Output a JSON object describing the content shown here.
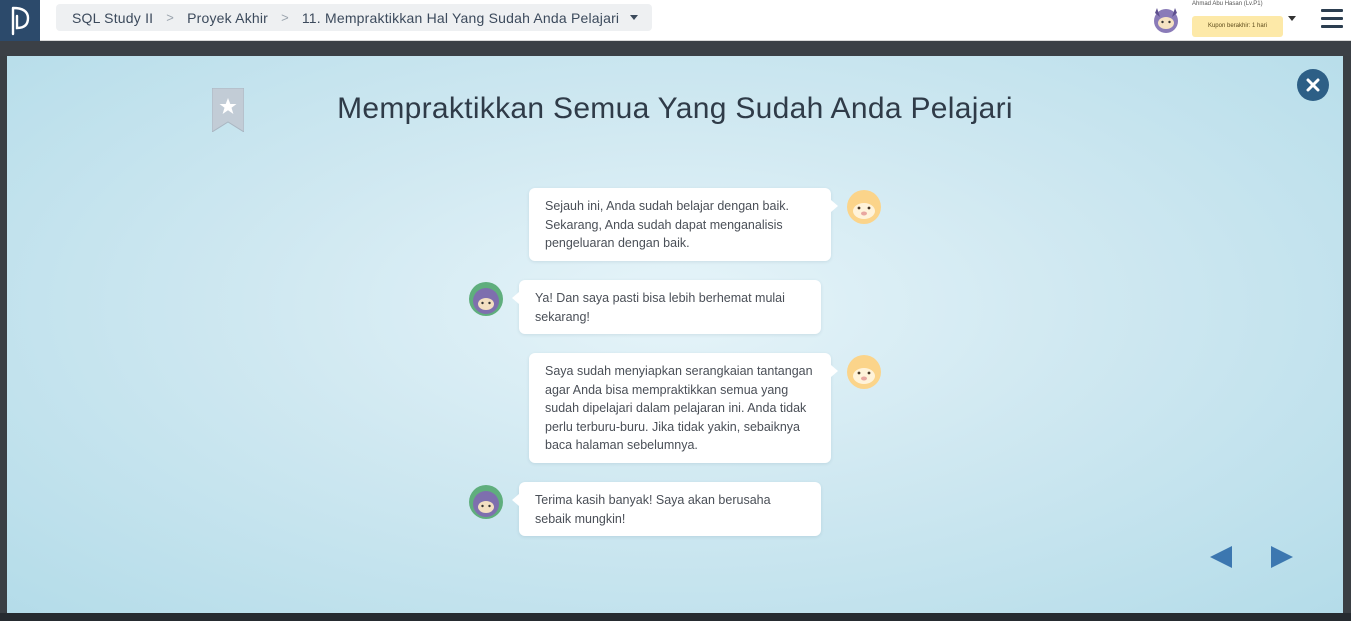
{
  "breadcrumb": {
    "course": "SQL Study II",
    "section": "Proyek Akhir",
    "lesson": "11. Mempraktikkan Hal Yang Sudah Anda Pelajari"
  },
  "user": {
    "name": "Ahmad Abu Hasan (Lv.P1)",
    "coupon": "Kupon berakhir: 1 hari"
  },
  "modal": {
    "title": "Mempraktikkan Semua Yang Sudah Anda Pelajari",
    "messages": [
      {
        "speaker": "teacher",
        "text": "Sejauh ini, Anda sudah belajar dengan baik. Sekarang, Anda sudah dapat menganalisis pengeluaran dengan baik."
      },
      {
        "speaker": "student",
        "text": "Ya! Dan saya pasti bisa lebih berhemat mulai sekarang!"
      },
      {
        "speaker": "teacher",
        "text": "Saya sudah menyiapkan serangkaian tantangan agar Anda bisa mempraktikkan semua  yang sudah dipelajari dalam pelajaran ini. Anda tidak perlu terburu-buru. Jika tidak yakin, sebaiknya baca halaman sebelumnya."
      },
      {
        "speaker": "student",
        "text": "Terima kasih banyak! Saya akan berusaha sebaik mungkin!"
      }
    ]
  },
  "icons": {
    "logo": "progate-logo-icon",
    "close": "close-icon",
    "bookmark": "bookmark-star-icon",
    "prev": "triangle-left-icon",
    "next": "triangle-right-icon",
    "menu": "hamburger-menu-icon"
  },
  "colors": {
    "brand": "#2c4a6b",
    "accent": "#2d5f86",
    "coupon_bg": "#fde9a8"
  }
}
